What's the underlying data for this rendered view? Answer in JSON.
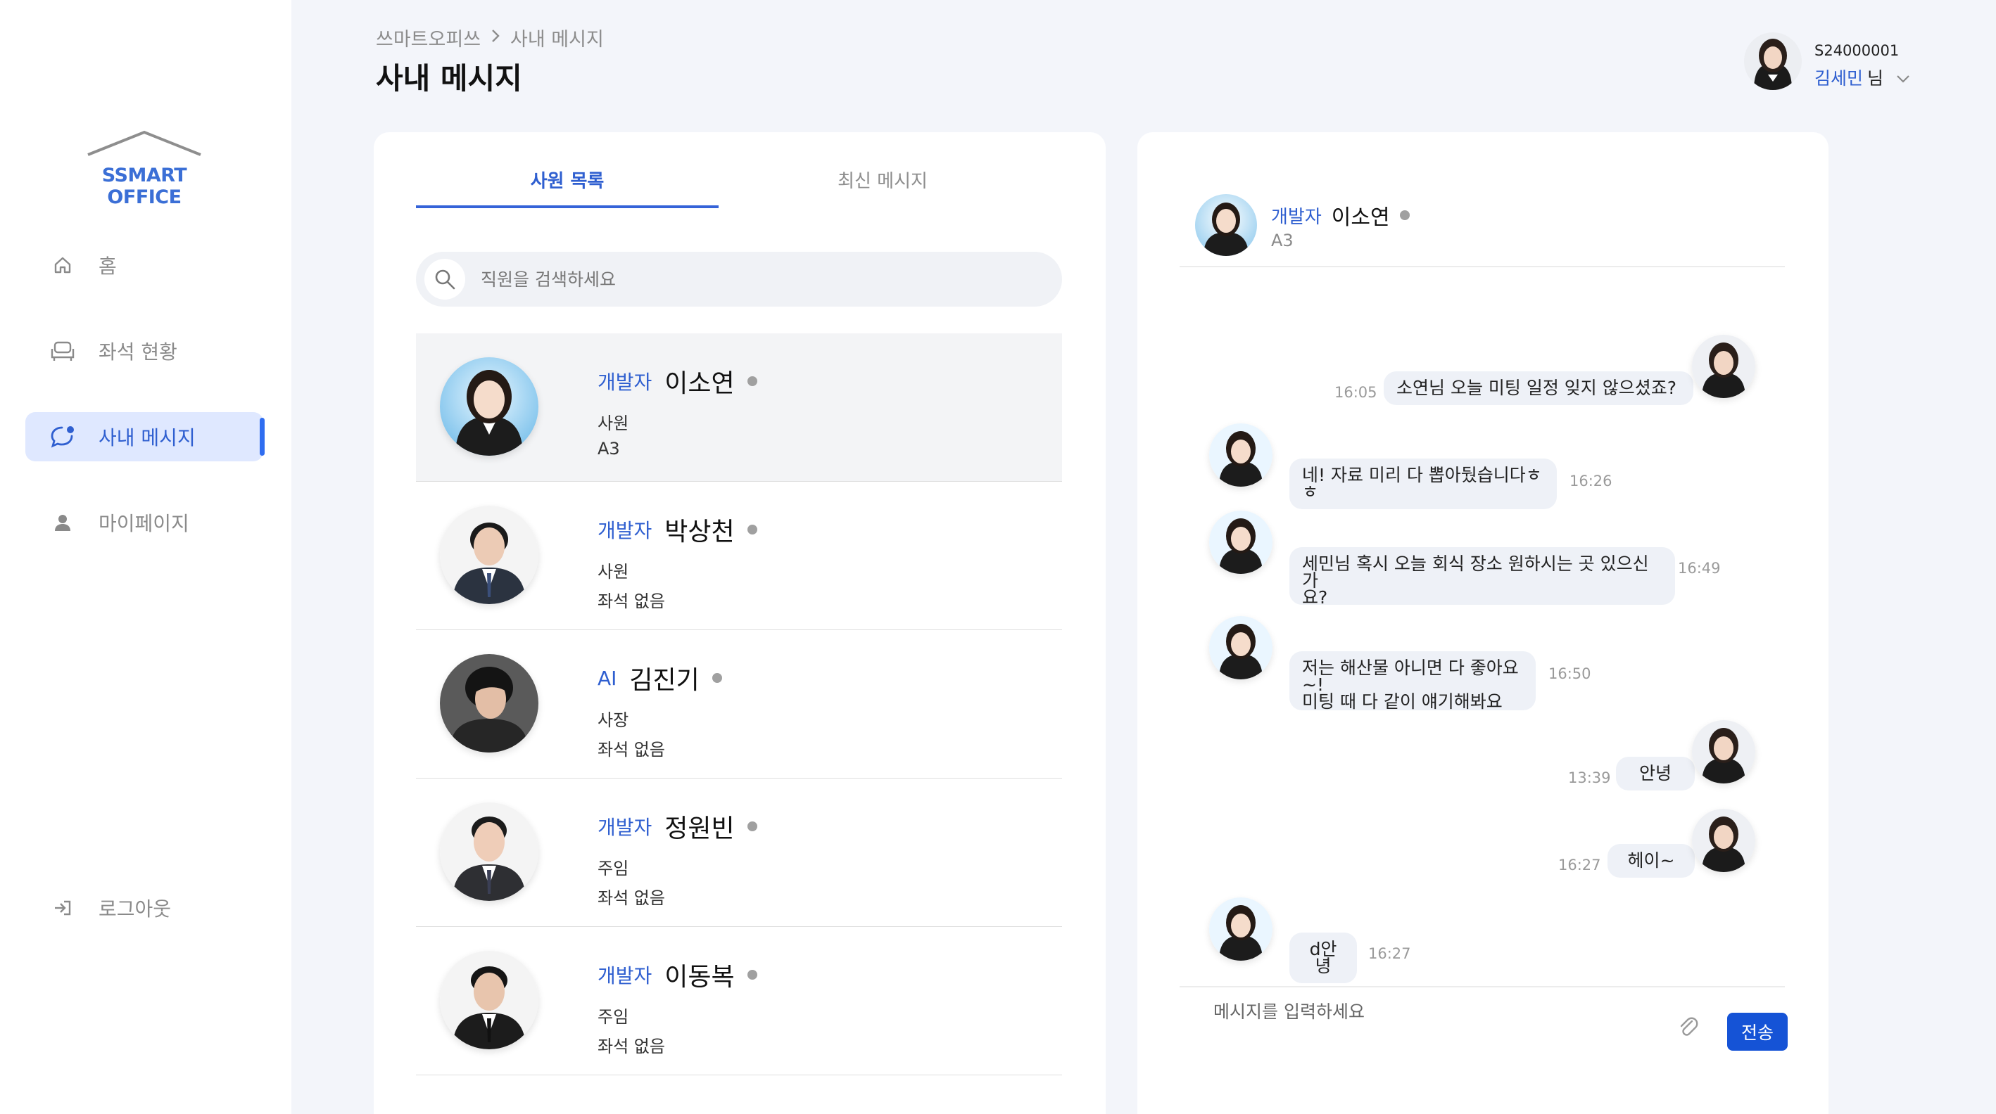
{
  "sidebar": {
    "logo_text": "SSMART OFFICE",
    "items": [
      {
        "label": "홈",
        "icon": "home-icon"
      },
      {
        "label": "좌석 현황",
        "icon": "chair-icon"
      },
      {
        "label": "사내 메시지",
        "icon": "chat-icon"
      },
      {
        "label": "마이페이지",
        "icon": "person-icon"
      }
    ],
    "logout_label": "로그아웃"
  },
  "header": {
    "breadcrumb": [
      "쓰마트오피쓰",
      "사내 메시지"
    ],
    "title": "사내 메시지",
    "user_id": "S24000001",
    "user_name": "김세민",
    "user_suffix": "님"
  },
  "tabs": [
    "사원 목록",
    "최신 메시지"
  ],
  "search": {
    "placeholder": "직원을 검색하세요"
  },
  "employees": [
    {
      "role": "개발자",
      "name": "이소연",
      "title": "사원",
      "seat": "A3"
    },
    {
      "role": "개발자",
      "name": "박상천",
      "title": "사원",
      "seat": "좌석 없음"
    },
    {
      "role": "AI",
      "name": "김진기",
      "title": "사장",
      "seat": "좌석 없음"
    },
    {
      "role": "개발자",
      "name": "정원빈",
      "title": "주임",
      "seat": "좌석 없음"
    },
    {
      "role": "개발자",
      "name": "이동복",
      "title": "주임",
      "seat": "좌석 없음"
    }
  ],
  "chat": {
    "role": "개발자",
    "name": "이소연",
    "seat": "A3",
    "messages": [
      {
        "from": "me",
        "text": "소연님 오늘 미팅 일정 잊지 않으셨죠?",
        "time": "16:05"
      },
      {
        "from": "other",
        "text": "네! 자료 미리 다 뽑아뒀습니다ㅎㅎ",
        "time": "16:26"
      },
      {
        "from": "other",
        "text": "세민님 혹시 오늘 회식 장소 원하시는 곳 있으신가\n요?",
        "time": "16:49"
      },
      {
        "from": "other",
        "text": "저는 해산물 아니면 다 좋아요~!\n미팅 때 다 같이 얘기해봐요",
        "time": "16:50"
      },
      {
        "from": "me",
        "text": "안녕",
        "time": "13:39"
      },
      {
        "from": "me",
        "text": "헤이~",
        "time": "16:27"
      },
      {
        "from": "other",
        "text": "d안녕",
        "time": "16:27"
      }
    ],
    "composer_placeholder": "메시지를 입력하세요",
    "send_label": "전송"
  },
  "colors": {
    "accent": "#2f5fd0",
    "send_button": "#1553d6",
    "active_nav_bg": "#dfe8ff"
  }
}
